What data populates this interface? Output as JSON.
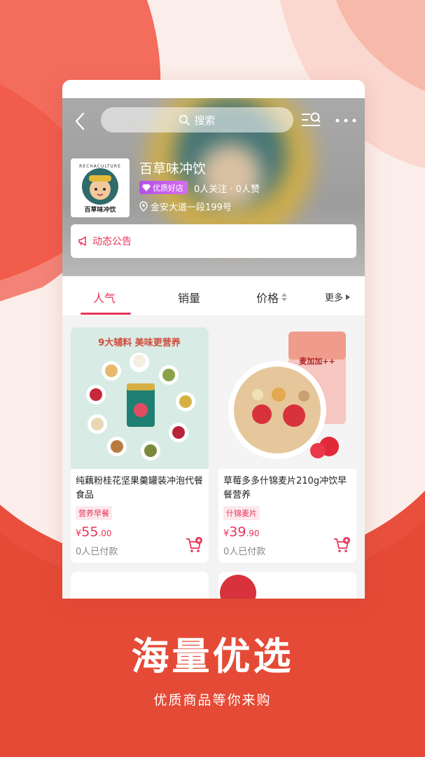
{
  "colors": {
    "accent": "#e8345a",
    "promo_red": "#e8503d",
    "header_gray": "#a3a3a3",
    "badge_purple": "#c060ec"
  },
  "header": {
    "search_placeholder": "搜索",
    "back_icon": "chevron-left-icon",
    "list_icon": "list-search-icon",
    "more_icon": "more-dots-icon"
  },
  "store": {
    "logo_brand": "RECHACULTURE",
    "logo_name": "百草味冲饮",
    "name": "百草味冲饮",
    "badge": "优质好店",
    "stats": "0人关注 · 0人赞",
    "address": "金安大道一段199号",
    "notice": "动态公告"
  },
  "tabs": [
    {
      "label": "人气"
    },
    {
      "label": "销量"
    },
    {
      "label": "价格"
    },
    {
      "label": "更多"
    }
  ],
  "products": [
    {
      "banner": "9大辅料 美味更营养",
      "title": "纯藕粉桂花坚果羹罐装冲泡代餐食品",
      "tag": "营养早餐",
      "price_symbol": "¥",
      "price_int": "55",
      "price_dec": ".00",
      "paid": "0人已付款"
    },
    {
      "banner": "麦加加++",
      "title": "草莓多多什锦麦片210g冲饮早餐营养",
      "tag": "什锦麦片",
      "price_symbol": "¥",
      "price_int": "39",
      "price_dec": ".90",
      "paid": "0人已付款"
    }
  ],
  "promo": {
    "title": "海量优选",
    "subtitle": "优质商品等你来购"
  }
}
